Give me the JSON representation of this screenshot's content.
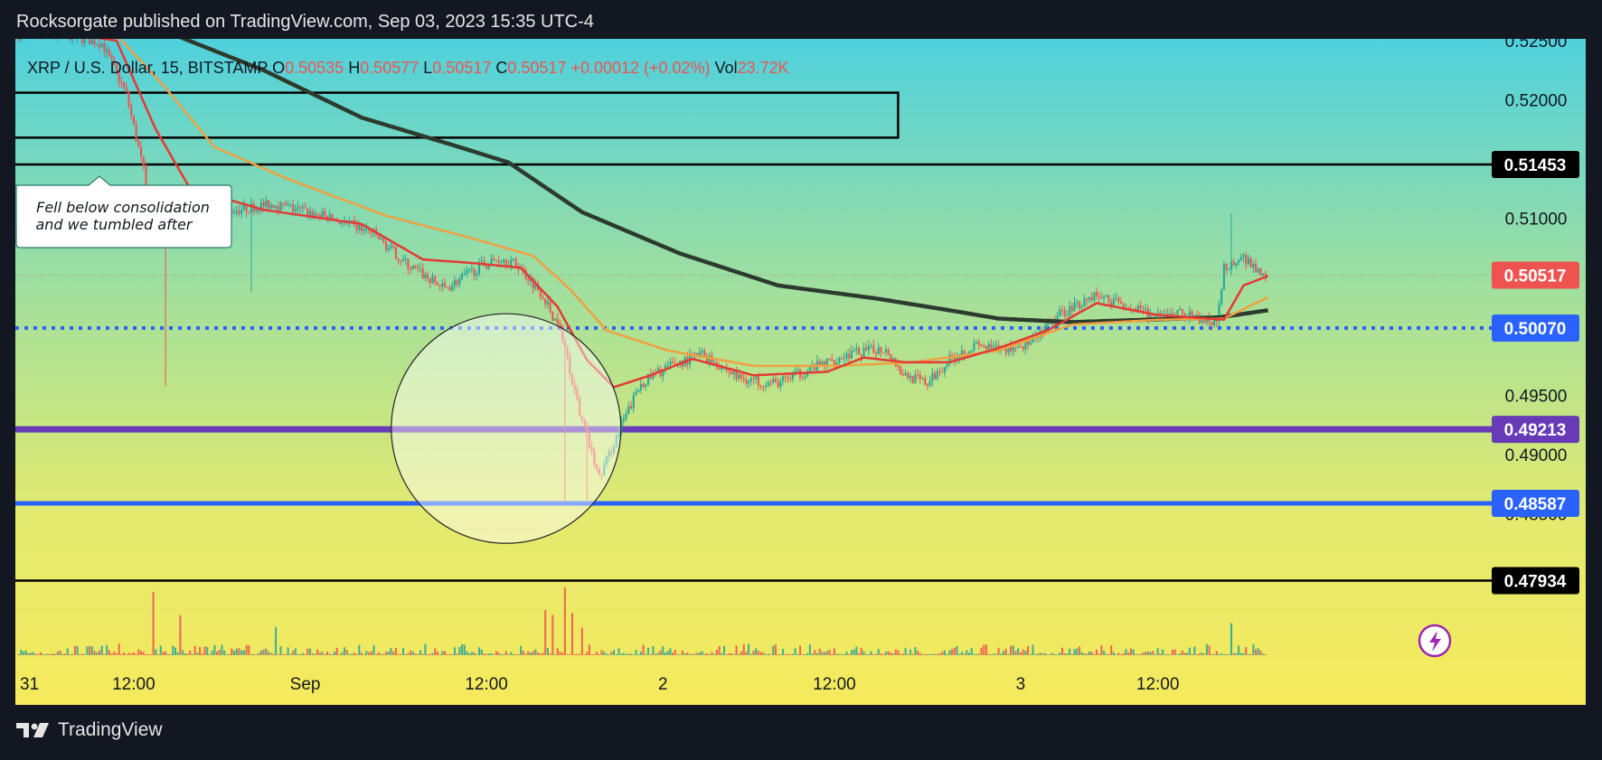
{
  "header": {
    "publisher": "Rocksorgate published on TradingView.com, Sep 03, 2023 15:35 UTC-4"
  },
  "legend": {
    "symbol": "XRP / U.S. Dollar, 15, BITSTAMP",
    "o_label": "O",
    "o_value": "0.50535",
    "h_label": "H",
    "h_value": "0.50577",
    "l_label": "L",
    "l_value": "0.50517",
    "c_label": "C",
    "c_value": "0.50517",
    "change": "+0.00012 (+0.02%)",
    "vol_label": "Vol",
    "vol_value": "23.72K"
  },
  "annotation": {
    "line1": "Fell below consolidation",
    "line2": "and we tumbled after"
  },
  "footer": {
    "brand": "TradingView"
  },
  "colors": {
    "up": "#26a69a",
    "down": "#ef5350",
    "ema_fast": "#e53935",
    "ema_slow": "#f0a040",
    "ma_long": "#2d3b2e",
    "level_purple": "#673ab7",
    "level_blue": "#2962ff",
    "level_black": "#000000",
    "dotted": "#2962ff",
    "last_price": "#ef5350"
  },
  "chart_data": {
    "type": "candlestick",
    "symbol": "XRP / U.S. Dollar",
    "interval": "15",
    "exchange": "BITSTAMP",
    "x_tick_labels": [
      "31",
      "12:00",
      "Sep",
      "12:00",
      "2",
      "12:00",
      "3",
      "12:00"
    ],
    "y_tick_labels": [
      "0.52500",
      "0.52000",
      "0.51000",
      "0.50500",
      "0.49500",
      "0.49000",
      "0.48500"
    ],
    "ylim": [
      0.4793,
      0.5258
    ],
    "x_ticks_idx": [
      0,
      47,
      117,
      191,
      263,
      333,
      409,
      465
    ],
    "n_bars": 510,
    "anchors": [
      [
        0,
        0.5255
      ],
      [
        20,
        0.5255
      ],
      [
        35,
        0.5248
      ],
      [
        45,
        0.5205
      ],
      [
        52,
        0.514
      ],
      [
        55,
        0.5085
      ],
      [
        70,
        0.5098
      ],
      [
        90,
        0.5107
      ],
      [
        105,
        0.5112
      ],
      [
        125,
        0.5102
      ],
      [
        145,
        0.5088
      ],
      [
        160,
        0.506
      ],
      [
        175,
        0.504
      ],
      [
        190,
        0.506
      ],
      [
        198,
        0.5066
      ],
      [
        205,
        0.506
      ],
      [
        215,
        0.5035
      ],
      [
        223,
        0.5
      ],
      [
        230,
        0.4935
      ],
      [
        238,
        0.488
      ],
      [
        246,
        0.492
      ],
      [
        255,
        0.496
      ],
      [
        265,
        0.4973
      ],
      [
        280,
        0.4985
      ],
      [
        295,
        0.4965
      ],
      [
        310,
        0.496
      ],
      [
        325,
        0.4973
      ],
      [
        340,
        0.4985
      ],
      [
        355,
        0.499
      ],
      [
        362,
        0.4968
      ],
      [
        372,
        0.496
      ],
      [
        382,
        0.4983
      ],
      [
        392,
        0.4992
      ],
      [
        402,
        0.4988
      ],
      [
        415,
        0.4995
      ],
      [
        427,
        0.502
      ],
      [
        440,
        0.5035
      ],
      [
        455,
        0.5025
      ],
      [
        465,
        0.5015
      ],
      [
        475,
        0.502
      ],
      [
        482,
        0.5015
      ],
      [
        490,
        0.501
      ],
      [
        493,
        0.5058
      ],
      [
        500,
        0.5068
      ],
      [
        510,
        0.5052
      ]
    ],
    "ema_fast_anchors": [
      [
        0,
        0.5262
      ],
      [
        40,
        0.525
      ],
      [
        56,
        0.5175
      ],
      [
        70,
        0.5125
      ],
      [
        100,
        0.5107
      ],
      [
        140,
        0.5095
      ],
      [
        165,
        0.5065
      ],
      [
        185,
        0.5062
      ],
      [
        205,
        0.5058
      ],
      [
        220,
        0.5025
      ],
      [
        232,
        0.498
      ],
      [
        243,
        0.4957
      ],
      [
        258,
        0.4967
      ],
      [
        275,
        0.4981
      ],
      [
        300,
        0.4967
      ],
      [
        330,
        0.497
      ],
      [
        345,
        0.4982
      ],
      [
        362,
        0.4978
      ],
      [
        380,
        0.4978
      ],
      [
        400,
        0.499
      ],
      [
        420,
        0.5005
      ],
      [
        440,
        0.5028
      ],
      [
        465,
        0.5018
      ],
      [
        492,
        0.5014
      ],
      [
        500,
        0.5043
      ],
      [
        510,
        0.5051
      ]
    ],
    "ema_slow_anchors": [
      [
        0,
        0.5265
      ],
      [
        40,
        0.5255
      ],
      [
        60,
        0.521
      ],
      [
        80,
        0.516
      ],
      [
        110,
        0.5133
      ],
      [
        150,
        0.5102
      ],
      [
        185,
        0.5083
      ],
      [
        210,
        0.5068
      ],
      [
        225,
        0.504
      ],
      [
        240,
        0.5005
      ],
      [
        265,
        0.4988
      ],
      [
        300,
        0.4975
      ],
      [
        335,
        0.4975
      ],
      [
        365,
        0.4978
      ],
      [
        400,
        0.4988
      ],
      [
        430,
        0.501
      ],
      [
        465,
        0.5014
      ],
      [
        492,
        0.5015
      ],
      [
        510,
        0.5033
      ]
    ],
    "ma_long_anchors": [
      [
        55,
        0.5262
      ],
      [
        100,
        0.5225
      ],
      [
        140,
        0.5185
      ],
      [
        180,
        0.516
      ],
      [
        200,
        0.5147
      ],
      [
        230,
        0.5105
      ],
      [
        270,
        0.507
      ],
      [
        310,
        0.5043
      ],
      [
        350,
        0.5032
      ],
      [
        380,
        0.5022
      ],
      [
        400,
        0.5015
      ],
      [
        430,
        0.5012
      ],
      [
        460,
        0.5014
      ],
      [
        490,
        0.5016
      ],
      [
        510,
        0.5022
      ]
    ],
    "levels": [
      {
        "price": 0.51453,
        "label": "0.51453",
        "color": "black"
      },
      {
        "price": 0.50517,
        "label": "0.50517",
        "color": "last_price"
      },
      {
        "price": 0.5007,
        "label": "0.50070",
        "color": "dotted"
      },
      {
        "price": 0.49213,
        "label": "0.49213",
        "color": "purple"
      },
      {
        "price": 0.48587,
        "label": "0.48587",
        "color": "blue"
      },
      {
        "price": 0.47934,
        "label": "0.47934",
        "color": "black"
      }
    ],
    "consolidation_box": {
      "from_idx": 0,
      "to_idx": 359,
      "top": 0.5206,
      "bottom": 0.5168
    },
    "highlight_circle": {
      "center_idx": 199,
      "center_price": 0.4922,
      "note": "highlighted drop zone"
    },
    "annotation_box_idx": 33
  }
}
